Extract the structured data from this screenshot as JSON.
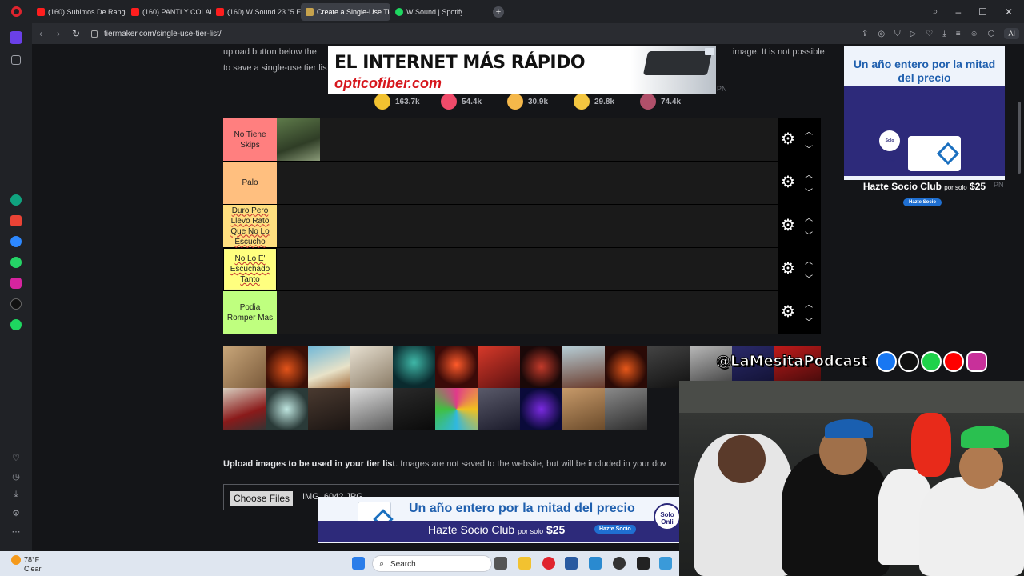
{
  "tabs": [
    {
      "label": "(160) Subimos De Rango",
      "favicon": "youtube-icon",
      "active": false
    },
    {
      "label": "(160) PANTI Y COLALE 2.0",
      "favicon": "youtube-icon",
      "active": false
    },
    {
      "label": "(160) W Sound 23 \"5 Estr",
      "favicon": "youtube-icon",
      "active": false
    },
    {
      "label": "Create a Single-Use Tier L",
      "favicon": "tiermaker-icon",
      "active": true
    },
    {
      "label": "W Sound | Spotify",
      "favicon": "spotify-icon",
      "active": false
    }
  ],
  "address": {
    "url": "tiermaker.com/single-use-tier-list/",
    "ai_label": "AI"
  },
  "page": {
    "intro_text_1": "upload button below the",
    "intro_text_1_end": "image. It is not possible",
    "intro_text_2": "to save a single-use tier lis"
  },
  "top_ad": {
    "line1": "EL INTERNET MÁS RÁPIDO",
    "line2": "opticofiber.com",
    "pn": "PN"
  },
  "reactions": [
    {
      "icon": "laugh-emoji-icon",
      "count": "163.7k",
      "color": "#f2c230"
    },
    {
      "icon": "heart-eyes-emoji-icon",
      "count": "54.4k",
      "color": "#ef4b6a"
    },
    {
      "icon": "tears-joy-emoji-icon",
      "count": "30.9k",
      "color": "#f5b84a"
    },
    {
      "icon": "raised-hands-emoji-icon",
      "count": "29.8k",
      "color": "#f3c640"
    },
    {
      "icon": "poop-emoji-icon",
      "count": "74.4k",
      "color": "#b0506a"
    }
  ],
  "tiers": [
    {
      "label": "No Tiene Skips",
      "color": "#ff7f7f",
      "wavy": false,
      "selected": false
    },
    {
      "label": "Palo",
      "color": "#ffbf7f",
      "wavy": false,
      "selected": false
    },
    {
      "label": "Duro Pero Llevo Rato Que No Lo Escucho",
      "color": "#ffdf7f",
      "wavy": true,
      "selected": false
    },
    {
      "label": "No Lo E' Escuchado Tanto",
      "color": "#ffff7f",
      "wavy": true,
      "selected": true
    },
    {
      "label": "Podia Romper Mas",
      "color": "#bfff7f",
      "wavy": false,
      "selected": false
    }
  ],
  "upload": {
    "bold": "Upload images to be used in your tier list",
    "rest": ". Images are not saved to the website, but will be included in your dov",
    "button": "Choose Files",
    "file": "IMG_6042.JPG"
  },
  "right_ad": {
    "headline": "Un año entero por la mitad del precio",
    "solo": "Solo Online",
    "socio": "Hazte Socio Club",
    "socio_small": "por solo",
    "price": "$25",
    "pill": "Hazte Socio",
    "pn": "PN"
  },
  "bottom_ad": {
    "headline": "Un año entero por la mitad del precio",
    "socio": "Hazte Socio Club",
    "socio_small": "por solo",
    "price": "$25",
    "pill": "Hazte Socio",
    "side": "Solo Onli"
  },
  "podcast": {
    "handle": "@LaMesitaPodcast"
  },
  "taskbar": {
    "temp": "78°F",
    "condition": "Clear",
    "search": "Search"
  }
}
